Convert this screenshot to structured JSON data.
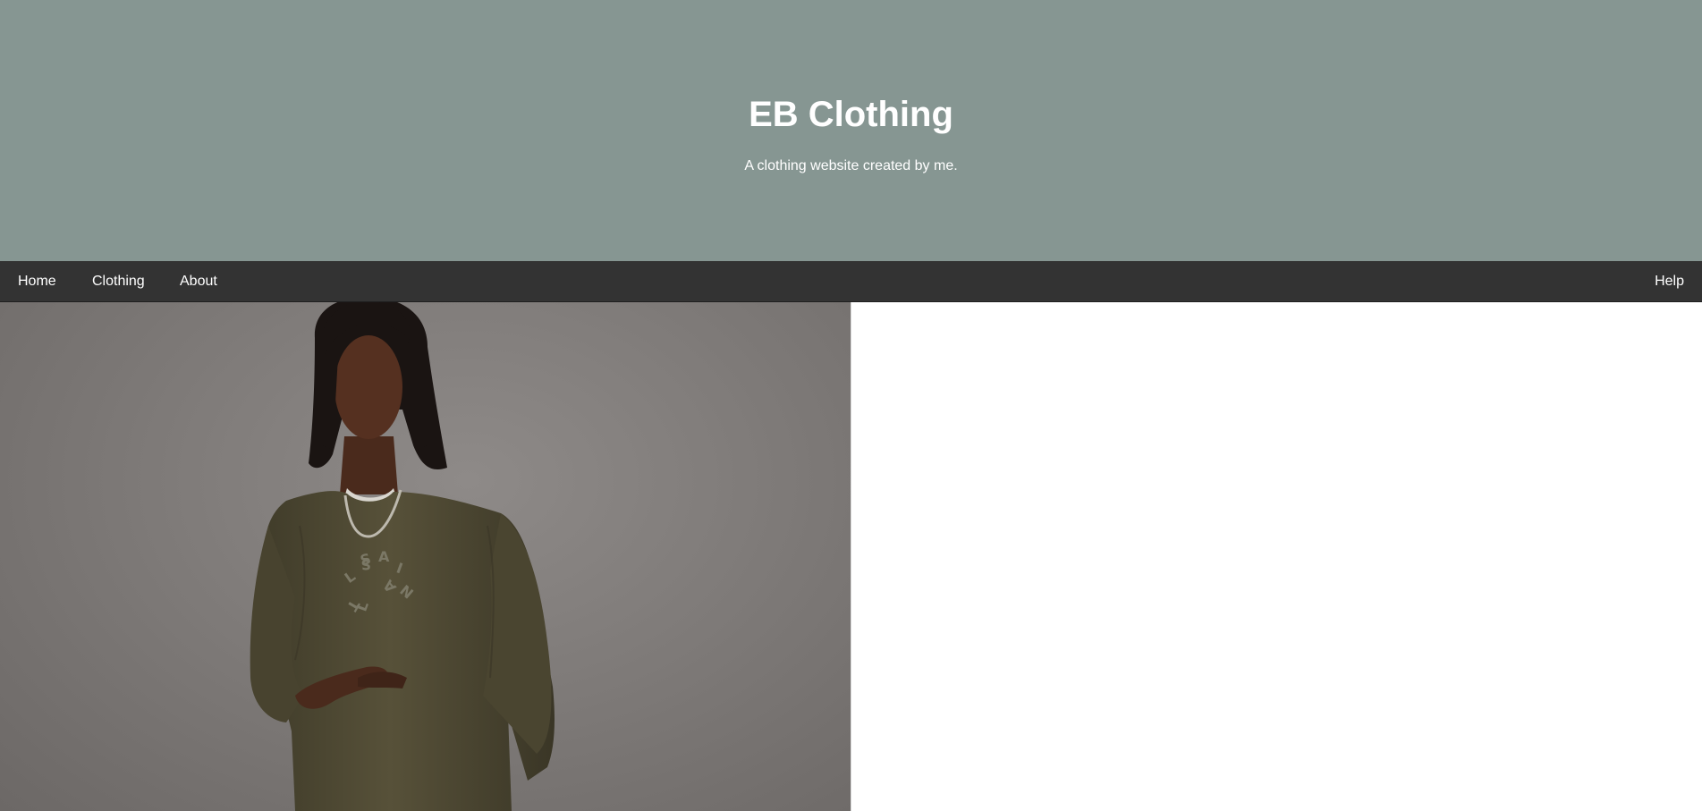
{
  "header": {
    "title": "EB Clothing",
    "subtitle": "A clothing website created by me.",
    "background_color": "#869692"
  },
  "nav": {
    "background_color": "#333333",
    "items": [
      {
        "label": "Home"
      },
      {
        "label": "Clothing"
      },
      {
        "label": "About"
      }
    ],
    "help_label": "Help"
  },
  "main": {
    "hero_image": {
      "subject": "man-in-olive-sweatshirt-photo",
      "sweatshirt_logo_text": "ALLSAINTS"
    }
  },
  "colors": {
    "text_light": "#ffffff",
    "sweatshirt": "#4f4a35"
  }
}
